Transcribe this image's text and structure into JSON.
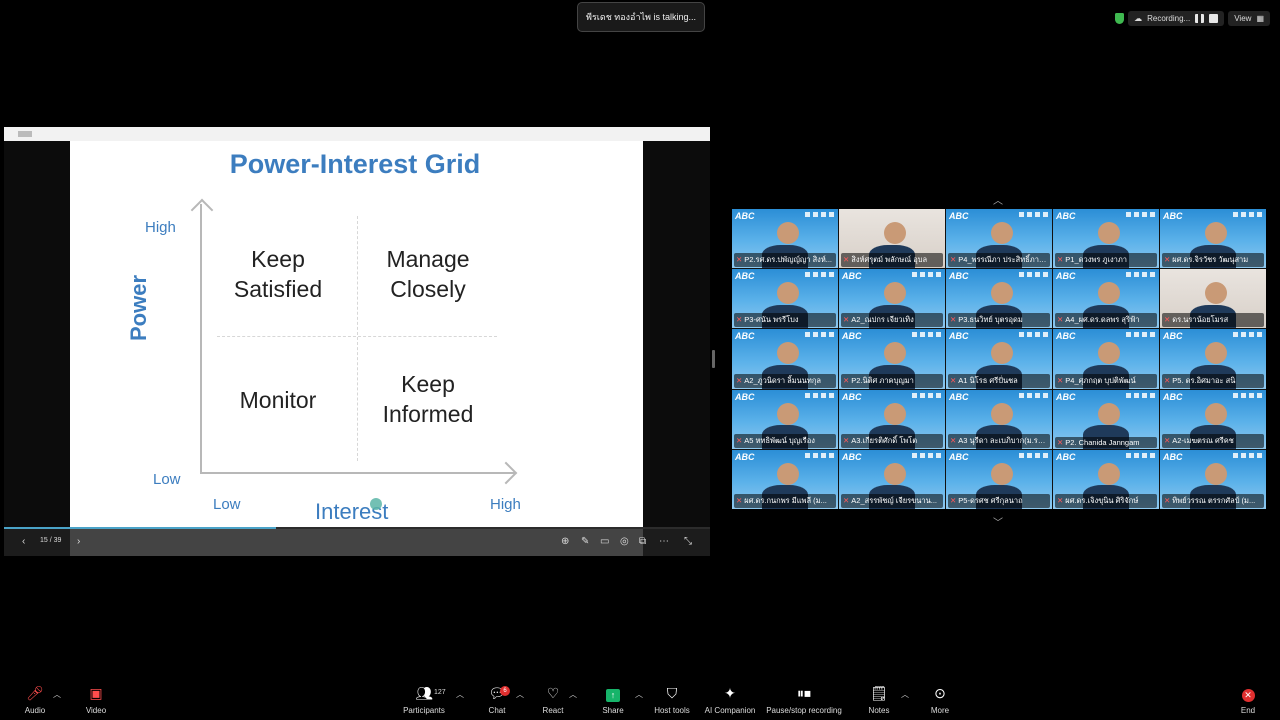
{
  "toast": {
    "talking": "พีรเดช ทองอำไพ is talking..."
  },
  "status": {
    "recording": "Recording...",
    "view": "View"
  },
  "slide": {
    "title": "Power-Interest Grid",
    "high_y": "High",
    "low_y": "Low",
    "power": "Power",
    "low_x": "Low",
    "interest": "Interest",
    "high_x": "High",
    "q_tl_1": "Keep",
    "q_tl_2": "Satisfied",
    "q_tr_1": "Manage",
    "q_tr_2": "Closely",
    "q_bl": "Monitor",
    "q_br_1": "Keep",
    "q_br_2": "Informed"
  },
  "slide_controls": {
    "page": "15 / 39",
    "progress": 0.385
  },
  "gallery": {
    "logo": "ABC",
    "participants": [
      "P2.รศ.ดร.ปพัญญ์ญา สิงห์...",
      "สิงห์ศรุตม์ พลักษณ์ อุบล",
      "P4_พรรณีภา ประสิทธิ์ภากร...",
      "P1_ดวงพร ภูเงาภา",
      "ผศ.ดร.จิรวัชร วัฒนุสาม",
      "P3-ศนัน พรรีโบง",
      "A2_ณปกร เจียวเทิง",
      "P3.ธนวิทย์ บุตรอุดม",
      "A4_ผศ.ดร.ดลพร สุริฟ้า",
      "ดร.นราน้อยโมรส",
      "A2_ภูวนิดรา ลิ้มนนทกุล",
      "P2.นิติศ ภาคบุญมา",
      "A1 นิโรธ ศรีปั่นชล",
      "P4_ศุภกฤต บุปติพัฒน์",
      "P5. ดร.อิศมาอะ สนิ",
      "A5 หทธิพัฒน์ บุญเรือง",
      "A3.เกียรติศักดิ์ โพโต",
      "A3 นุรีดา ละเบภิบาก(ม.รา...",
      "P2. Chanida Janngam",
      "A2-เมฆตรณ ศรีคช",
      "ผศ.ดร.กนกพร มีแพลี (ม...",
      "A2_สรรพัชญ์ เจียรขนาน...",
      "P5-ดรศช ศรีกุลนาถ",
      "ผศ.ดร.เจิงขุนิน ศิริจักษ์",
      "ทิพย์วรรณ ตรรกศัลป์ (ม..."
    ]
  },
  "toolbar": {
    "audio": "Audio",
    "video": "Video",
    "participants": "Participants",
    "participants_count": "127",
    "chat": "Chat",
    "chat_badge": "6",
    "react": "React",
    "share": "Share",
    "host_tools": "Host tools",
    "ai_companion": "AI Companion",
    "record": "Pause/stop recording",
    "notes": "Notes",
    "more": "More",
    "end": "End"
  },
  "colors": {
    "accent_blue": "#3c7dbf",
    "end_red": "#e02f2f",
    "share_green": "#17b46a",
    "secure_green": "#3fb950"
  }
}
